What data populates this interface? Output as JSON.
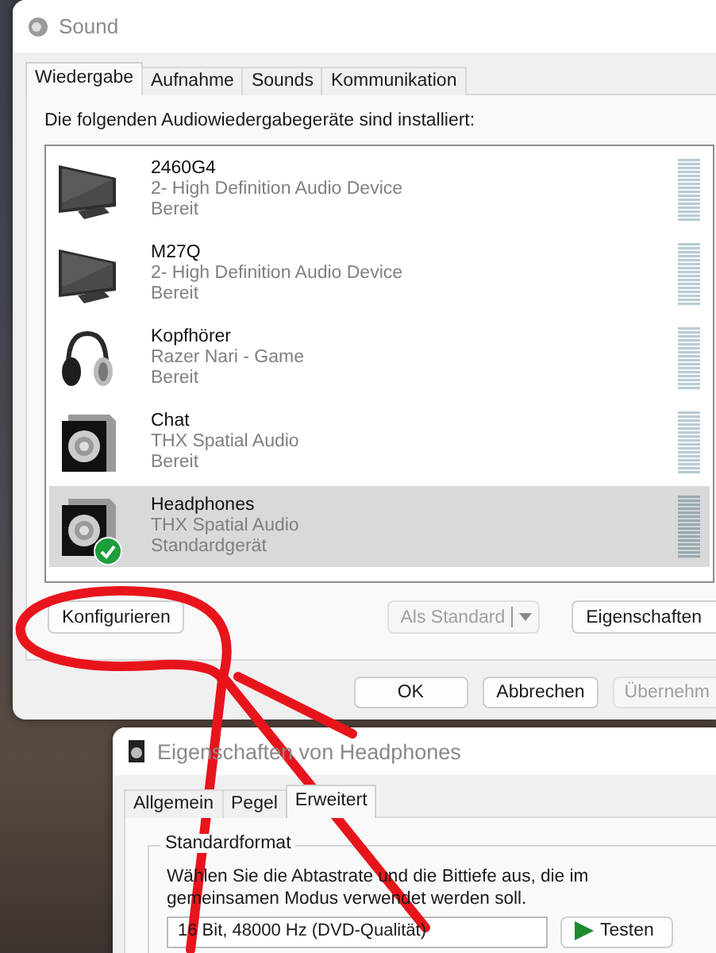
{
  "sound_window": {
    "title": "Sound",
    "tabs": [
      {
        "label": "Wiedergabe",
        "selected": true
      },
      {
        "label": "Aufnahme",
        "selected": false
      },
      {
        "label": "Sounds",
        "selected": false
      },
      {
        "label": "Kommunikation",
        "selected": false
      }
    ],
    "intro": "Die folgenden Audiowiedergabegeräte sind installiert:",
    "devices": [
      {
        "kind": "monitor",
        "name": "2460G4",
        "driver": "2- High Definition Audio Device",
        "status": "Bereit",
        "selected": false,
        "default": false
      },
      {
        "kind": "monitor",
        "name": "M27Q",
        "driver": "2- High Definition Audio Device",
        "status": "Bereit",
        "selected": false,
        "default": false
      },
      {
        "kind": "headphones",
        "name": "Kopfhörer",
        "driver": "Razer Nari - Game",
        "status": "Bereit",
        "selected": false,
        "default": false
      },
      {
        "kind": "speaker",
        "name": "Chat",
        "driver": "THX Spatial Audio",
        "status": "Bereit",
        "selected": false,
        "default": false
      },
      {
        "kind": "speaker",
        "name": "Headphones",
        "driver": "THX Spatial Audio",
        "status": "Standardgerät",
        "selected": true,
        "default": true
      }
    ],
    "buttons": [
      {
        "kind": "button",
        "label": "Konfigurieren",
        "disabled": false
      },
      {
        "kind": "split",
        "label": "Als Standard",
        "disabled": true
      },
      {
        "kind": "button",
        "label": "Eigenschaften",
        "disabled": false
      }
    ],
    "dialog_buttons": [
      {
        "label": "OK",
        "disabled": false
      },
      {
        "label": "Abbrechen",
        "disabled": false
      },
      {
        "label": "Übernehm",
        "disabled": true
      }
    ]
  },
  "properties_window": {
    "title": "Eigenschaften von Headphones",
    "tabs": [
      {
        "label": "Allgemein",
        "selected": false
      },
      {
        "label": "Pegel",
        "selected": false
      },
      {
        "label": "Erweitert",
        "selected": true
      }
    ],
    "group_title": "Standardformat",
    "description": "Wählen Sie die Abtastrate und die Bittiefe aus, die im gemeinsamen Modus verwendet werden soll.",
    "format": "16 Bit, 48000 Hz (DVD-Qualität)",
    "test_button": "Testen"
  }
}
